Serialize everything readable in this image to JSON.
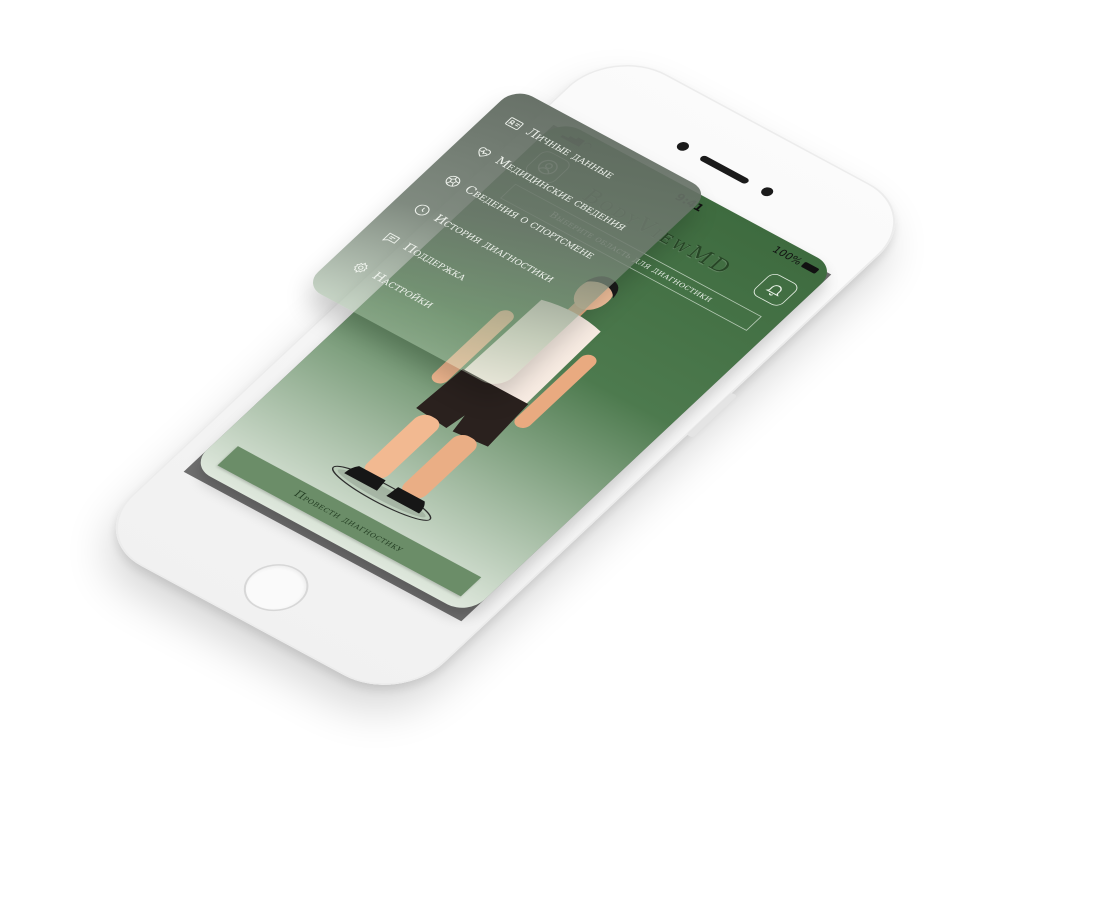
{
  "status_bar": {
    "time": "9:41",
    "battery": "100%"
  },
  "app": {
    "brand": "BodyViewMD",
    "subtitle": "Выберите область для диагностики",
    "primary_button": "Провести диагностику"
  },
  "menu": {
    "items": [
      {
        "label": "Личные данные",
        "icon": "id-card-icon"
      },
      {
        "label": "Медицинские сведения",
        "icon": "heart-pulse-icon"
      },
      {
        "label": "Сведения о спортсмене",
        "icon": "ball-icon"
      },
      {
        "label": "История диагностики",
        "icon": "clock-icon"
      },
      {
        "label": "Поддержка",
        "icon": "chat-icon"
      },
      {
        "label": "Настройки",
        "icon": "gear-icon"
      }
    ]
  },
  "colors": {
    "screen_green": "#3e6b3f",
    "button_green": "#6b8d68",
    "menu_gray": "#5f695f",
    "text_light": "#eef2ec"
  }
}
